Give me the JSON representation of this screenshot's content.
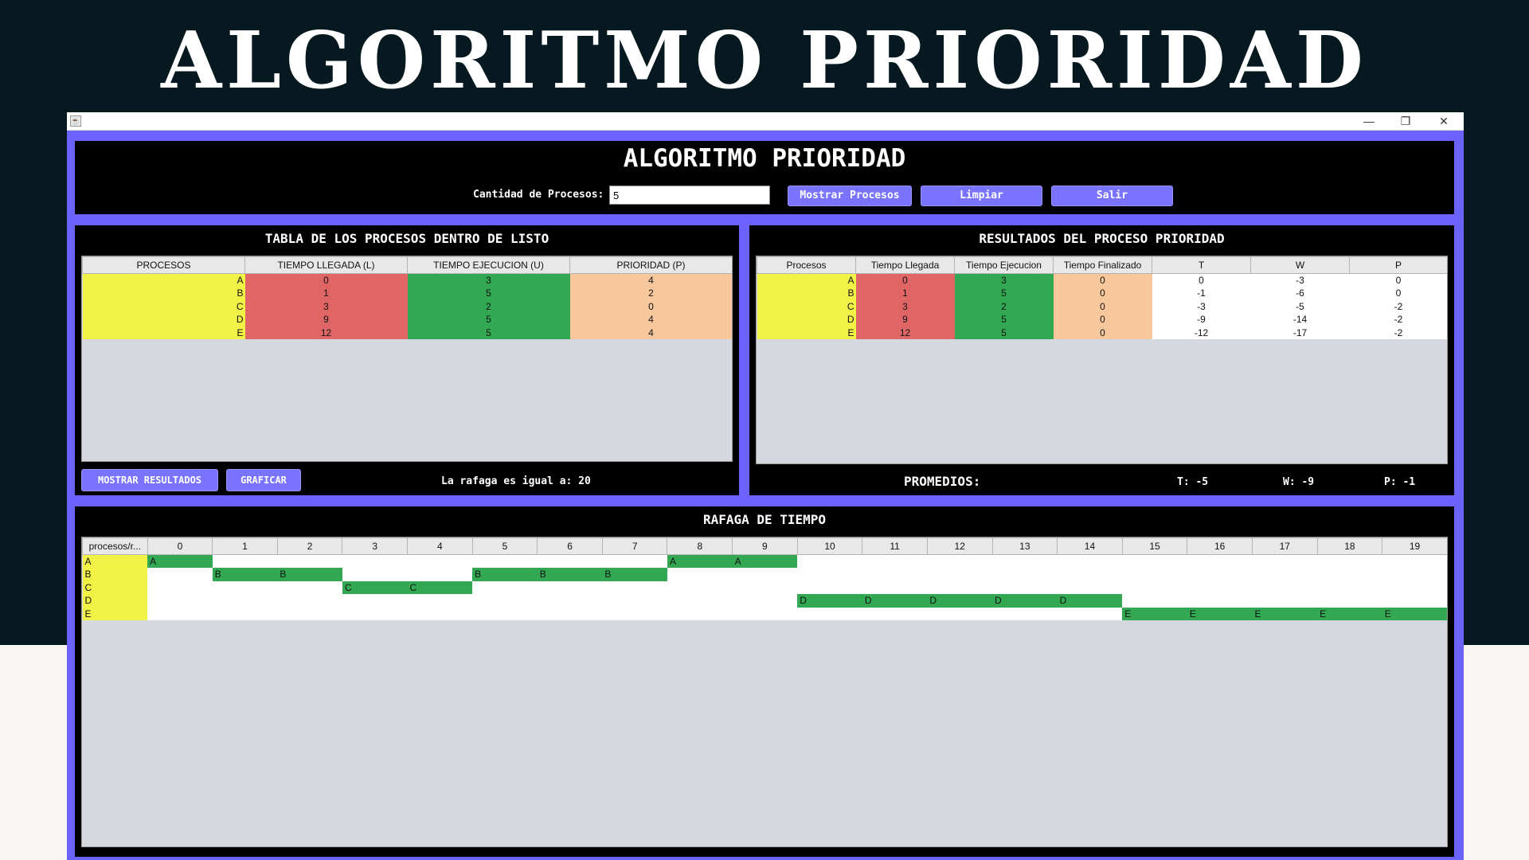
{
  "page_heading": "ALGORITMO PRIORIDAD",
  "window": {
    "minimize": "—",
    "maximize": "❐",
    "close": "✕"
  },
  "header": {
    "title": "ALGORITMO PRIORIDAD",
    "cantidad_label": "Cantidad de Procesos:",
    "cantidad_value": "5",
    "btn_mostrar": "Mostrar Procesos",
    "btn_limpiar": "Limpiar",
    "btn_salir": "Salir"
  },
  "left": {
    "title": "TABLA DE LOS PROCESOS DENTRO DE LISTO",
    "columns": [
      "PROCESOS",
      "TIEMPO LLEGADA (L)",
      "TIEMPO EJECUCION (U)",
      "PRIORIDAD (P)"
    ],
    "rows": [
      [
        "A",
        "0",
        "3",
        "4"
      ],
      [
        "B",
        "1",
        "5",
        "2"
      ],
      [
        "C",
        "3",
        "2",
        "0"
      ],
      [
        "D",
        "9",
        "5",
        "4"
      ],
      [
        "E",
        "12",
        "5",
        "4"
      ]
    ],
    "btn_resultados": "MOSTRAR RESULTADOS",
    "btn_graficar": "GRAFICAR",
    "rafaga_label": "La rafaga es igual a: 20"
  },
  "right": {
    "title": "RESULTADOS DEL PROCESO PRIORIDAD",
    "columns": [
      "Procesos",
      "Tiempo Llegada",
      "Tiempo Ejecucion",
      "Tiempo Finalizado",
      "T",
      "W",
      "P"
    ],
    "rows": [
      [
        "A",
        "0",
        "3",
        "0",
        "0",
        "-3",
        "0"
      ],
      [
        "B",
        "1",
        "5",
        "0",
        "-1",
        "-6",
        "0"
      ],
      [
        "C",
        "3",
        "2",
        "0",
        "-3",
        "-5",
        "-2"
      ],
      [
        "D",
        "9",
        "5",
        "0",
        "-9",
        "-14",
        "-2"
      ],
      [
        "E",
        "12",
        "5",
        "0",
        "-12",
        "-17",
        "-2"
      ]
    ],
    "promedios_label": "PROMEDIOS:",
    "prom_t": "T: -5",
    "prom_w": "W: -9",
    "prom_p": "P: -1"
  },
  "gantt": {
    "title": "RAFAGA DE TIEMPO",
    "corner_header": "procesos/r...",
    "time_headers": [
      "0",
      "1",
      "2",
      "3",
      "4",
      "5",
      "6",
      "7",
      "8",
      "9",
      "10",
      "11",
      "12",
      "13",
      "14",
      "15",
      "16",
      "17",
      "18",
      "19"
    ],
    "rows": [
      {
        "name": "A",
        "cells": [
          "A",
          "",
          "",
          "",
          "",
          "",
          "",
          "",
          "A",
          "A",
          "",
          "",
          "",
          "",
          "",
          "",
          "",
          "",
          "",
          ""
        ]
      },
      {
        "name": "B",
        "cells": [
          "",
          "B",
          "B",
          "",
          "",
          "B",
          "B",
          "B",
          "",
          "",
          "",
          "",
          "",
          "",
          "",
          "",
          "",
          "",
          "",
          ""
        ]
      },
      {
        "name": "C",
        "cells": [
          "",
          "",
          "",
          "C",
          "C",
          "",
          "",
          "",
          "",
          "",
          "",
          "",
          "",
          "",
          "",
          "",
          "",
          "",
          "",
          ""
        ]
      },
      {
        "name": "D",
        "cells": [
          "",
          "",
          "",
          "",
          "",
          "",
          "",
          "",
          "",
          "",
          "D",
          "D",
          "D",
          "D",
          "D",
          "",
          "",
          "",
          "",
          ""
        ]
      },
      {
        "name": "E",
        "cells": [
          "",
          "",
          "",
          "",
          "",
          "",
          "",
          "",
          "",
          "",
          "",
          "",
          "",
          "",
          "",
          "E",
          "E",
          "E",
          "E",
          "E"
        ]
      }
    ],
    "active": [
      [
        1,
        0,
        0,
        0,
        0,
        0,
        0,
        0,
        1,
        1,
        0,
        0,
        0,
        0,
        0,
        0,
        0,
        0,
        0,
        0
      ],
      [
        0,
        1,
        1,
        0,
        0,
        1,
        1,
        1,
        0,
        0,
        0,
        0,
        0,
        0,
        0,
        0,
        0,
        0,
        0,
        0
      ],
      [
        0,
        0,
        0,
        1,
        1,
        0,
        0,
        0,
        0,
        0,
        0,
        0,
        0,
        0,
        0,
        0,
        0,
        0,
        0,
        0
      ],
      [
        0,
        0,
        0,
        0,
        0,
        0,
        0,
        0,
        0,
        0,
        1,
        1,
        1,
        1,
        1,
        0,
        0,
        0,
        0,
        0
      ],
      [
        0,
        0,
        0,
        0,
        0,
        0,
        0,
        0,
        0,
        0,
        0,
        0,
        0,
        0,
        0,
        1,
        1,
        1,
        1,
        1
      ]
    ]
  },
  "colors": {
    "window_frame": "#6c63ff",
    "button": "#7a73ff",
    "process_yellow": "#f2f246",
    "arrival_red": "#e06666",
    "exec_green": "#32a852",
    "priority_orange": "#f8c89c"
  }
}
